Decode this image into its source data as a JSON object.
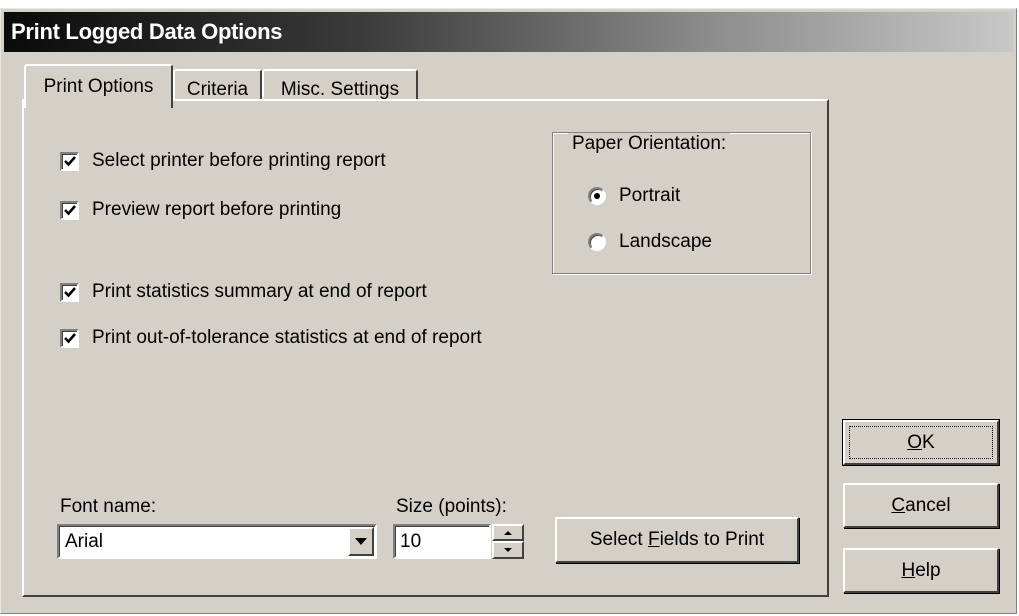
{
  "window": {
    "title": "Print Logged Data Options"
  },
  "tabs": [
    {
      "label": "Print Options",
      "active": true
    },
    {
      "label": "Criteria",
      "active": false
    },
    {
      "label": "Misc. Settings",
      "active": false
    }
  ],
  "options": [
    {
      "label": "Select printer before printing report",
      "checked": true
    },
    {
      "label": "Preview report before printing",
      "checked": true
    },
    {
      "label": "Print statistics summary at end of report",
      "checked": true
    },
    {
      "label": "Print out-of-tolerance statistics at end of report",
      "checked": true
    }
  ],
  "orientation": {
    "legend": "Paper Orientation:",
    "options": [
      {
        "label": "Portrait",
        "selected": true
      },
      {
        "label": "Landscape",
        "selected": false
      }
    ]
  },
  "font": {
    "name_label": "Font name:",
    "name_value": "Arial",
    "size_label": "Size (points):",
    "size_value": "10"
  },
  "buttons": {
    "select_fields": {
      "pre": "Select ",
      "accel": "F",
      "post": "ields to Print"
    },
    "ok": {
      "pre": "",
      "accel": "O",
      "post": "K"
    },
    "cancel": {
      "pre": "",
      "accel": "C",
      "post": "ancel"
    },
    "help": {
      "pre": "",
      "accel": "H",
      "post": "elp"
    }
  },
  "icons": {
    "checkmark": "checkmark-icon",
    "dropdown": "chevron-down-icon",
    "spin_up": "triangle-up-icon",
    "spin_down": "triangle-down-icon"
  }
}
